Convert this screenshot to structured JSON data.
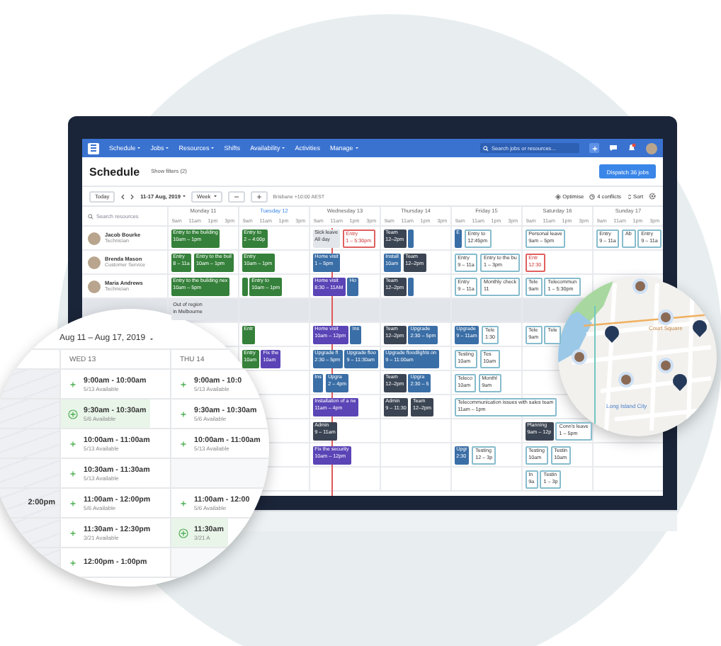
{
  "nav": {
    "items": [
      {
        "label": "Schedule",
        "dropdown": true
      },
      {
        "label": "Jobs",
        "dropdown": true
      },
      {
        "label": "Resources",
        "dropdown": true
      },
      {
        "label": "Shifts",
        "dropdown": false
      },
      {
        "label": "Availability",
        "dropdown": true
      },
      {
        "label": "Activities",
        "dropdown": false
      },
      {
        "label": "Manage",
        "dropdown": true
      }
    ],
    "search": {
      "placeholder": "Search jobs or resources..."
    }
  },
  "header": {
    "title": "Schedule",
    "filters": "Show filters (2)",
    "dispatch": "Dispatch 36 jobs"
  },
  "toolbar": {
    "today": "Today",
    "range": "11-17 Aug, 2019",
    "view": "Week",
    "timezone": "Brisbane +10:00 AEST",
    "optimise": "Optimise",
    "conflicts": "4 conflicts",
    "sort": "Sort"
  },
  "resource_search": {
    "placeholder": "Search resources"
  },
  "days": [
    {
      "name": "Monday 11",
      "selected": false,
      "times": [
        "9am",
        "11am",
        "1pm",
        "3pm"
      ]
    },
    {
      "name": "Tuesday 12",
      "selected": true,
      "times": [
        "9am",
        "11am",
        "1pm",
        "3pm"
      ]
    },
    {
      "name": "Wednesday 13",
      "selected": false,
      "times": [
        "9am",
        "11am",
        "1pm",
        "3pm"
      ]
    },
    {
      "name": "Thursday 14",
      "selected": false,
      "times": [
        "9am",
        "11am",
        "1pm",
        "3pm"
      ]
    },
    {
      "name": "Friday 15",
      "selected": false,
      "times": [
        "9am",
        "11am",
        "1pm",
        "3pm"
      ]
    },
    {
      "name": "Saturday 16",
      "selected": false,
      "times": [
        "9am",
        "11am",
        "1pm",
        "3pm"
      ]
    },
    {
      "name": "Sunday 17",
      "selected": false,
      "times": [
        "9am",
        "11am",
        "1pm",
        "3pm"
      ]
    }
  ],
  "rows": [
    {
      "name": "Jacob Bourke",
      "role": "Technician",
      "shaded": false,
      "days": {
        "mon": [
          {
            "kind": "job",
            "title": "Entry to the building",
            "time": "10am – 1pm"
          }
        ],
        "tue": [
          {
            "kind": "job",
            "title": "Entry to",
            "time": "2 – 4:00p"
          }
        ],
        "wed": [
          {
            "kind": "leave",
            "title": "Sick leave",
            "time": "All day"
          },
          {
            "kind": "alert",
            "title": "Entry",
            "time": "1 – 5:30pm"
          }
        ],
        "thu": [
          {
            "kind": "team",
            "title": "Team",
            "time": "12–2pm"
          },
          {
            "kind": "upgrade"
          }
        ],
        "fri": [
          {
            "kind": "upgrade",
            "title": "E"
          },
          {
            "kind": "outline",
            "title": "Entry to",
            "time": "12:45pm"
          }
        ],
        "sat": [
          {
            "kind": "outline",
            "title": "Personal leave",
            "time": "9am – 5pm"
          }
        ],
        "sun": [
          {
            "kind": "outline",
            "title": "Entry",
            "time": "9 – 11a"
          },
          {
            "kind": "outline",
            "title": "Ab"
          },
          {
            "kind": "outline",
            "title": "Entry",
            "time": "9 – 11a"
          }
        ]
      }
    },
    {
      "name": "Brenda Mason",
      "role": "Customer Service",
      "shaded": false,
      "days": {
        "mon": [
          {
            "kind": "job",
            "title": "Entry",
            "time": "8 – 11a"
          },
          {
            "kind": "job",
            "title": "Entry to the buil",
            "time": "10am – 1pm"
          }
        ],
        "tue": [
          {
            "kind": "job",
            "title": "Entry",
            "time": "10am – 1pm"
          }
        ],
        "wed": [
          {
            "kind": "upgrade",
            "title": "Home visit",
            "time": "1 – 5pm"
          }
        ],
        "thu": [
          {
            "kind": "upgrade",
            "title": "Install",
            "time": "10am"
          },
          {
            "kind": "team",
            "title": "Team",
            "time": "12–2pm"
          }
        ],
        "fri": [
          {
            "kind": "outline",
            "title": "Entry",
            "time": "9 – 11a"
          },
          {
            "kind": "outline",
            "title": "Entry to the bu",
            "time": "1 – 3pm"
          }
        ],
        "sat": [
          {
            "kind": "alert",
            "title": "Entr",
            "time": "12:30"
          }
        ]
      }
    },
    {
      "name": "Maria Andrews",
      "role": "Technician",
      "shaded": false,
      "days": {
        "mon": [
          {
            "kind": "job",
            "title": "Entry to the building nex",
            "time": "10am – 5pm"
          }
        ],
        "tue": [
          {
            "kind": "job"
          },
          {
            "kind": "job",
            "title": "Entry to",
            "time": "10am – 1pm"
          }
        ],
        "wed": [
          {
            "kind": "visit",
            "title": "Home visit",
            "time": "8:30 – 11AM"
          },
          {
            "kind": "upgrade",
            "title": "Ho"
          }
        ],
        "thu": [
          {
            "kind": "team",
            "title": "Team",
            "time": "12–2pm"
          },
          {
            "kind": "upgrade"
          }
        ],
        "fri": [
          {
            "kind": "outline",
            "title": "Entry",
            "time": "9 – 11a"
          },
          {
            "kind": "outline",
            "title": "Monthly check",
            "time": "11"
          }
        ],
        "sat": [
          {
            "kind": "outline",
            "title": "Tele",
            "time": "9am"
          },
          {
            "kind": "outline",
            "title": "Telecommun",
            "time": "1 – 5:30pm"
          }
        ]
      }
    },
    {
      "shaded": true,
      "days": {
        "mon": [
          {
            "kind": "leave",
            "title": "Out of region",
            "time": "in Melbourne"
          }
        ]
      }
    },
    {
      "shaded": false,
      "days": {
        "tue": [
          {
            "kind": "job",
            "title": "Entr"
          }
        ],
        "wed": [
          {
            "kind": "visit",
            "title": "Home visit",
            "time": "10am – 12pm"
          },
          {
            "kind": "upgrade",
            "title": "Ins"
          }
        ],
        "thu": [
          {
            "kind": "team",
            "title": "Team",
            "time": "12–2pm"
          },
          {
            "kind": "upgrade",
            "title": "Upgrade",
            "time": "2:30 – 5pm"
          }
        ],
        "fri": [
          {
            "kind": "upgrade",
            "title": "Upgrade",
            "time": "9 – 11am"
          },
          {
            "kind": "outline",
            "title": "Tele",
            "time": "1:30"
          }
        ],
        "sat": [
          {
            "kind": "outline",
            "title": "Tele",
            "time": "9am"
          },
          {
            "kind": "outline",
            "title": "Tele"
          }
        ]
      }
    },
    {
      "shaded": false,
      "days": {
        "tue": [
          {
            "kind": "job",
            "title": "Entry",
            "time": "10am"
          },
          {
            "kind": "visit",
            "title": "Fix the",
            "time": "10am"
          }
        ],
        "wed": [
          {
            "kind": "upgrade",
            "title": "Upgrade fl",
            "time": "2:30 – 5pm"
          },
          {
            "kind": "upgrade",
            "title": "Upgrade floo",
            "time": "9 – 11:30am"
          }
        ],
        "thu": [
          {
            "kind": "upgrade",
            "title": "Upgrade floodlights on",
            "time": "9 – 11:00am"
          }
        ],
        "fri": [
          {
            "kind": "outline",
            "title": "Testing",
            "time": "10am"
          },
          {
            "kind": "outline",
            "title": "Tes",
            "time": "10am"
          }
        ]
      }
    },
    {
      "shaded": false,
      "days": {
        "wed": [
          {
            "kind": "upgrade",
            "title": "Ins"
          },
          {
            "kind": "upgrade",
            "title": "Upgra",
            "time": "2 – 4pm"
          }
        ],
        "thu": [
          {
            "kind": "team",
            "title": "Team",
            "time": "12–2pm"
          },
          {
            "kind": "upgrade",
            "title": "Upgra",
            "time": "2:30 – 5"
          }
        ],
        "fri": [
          {
            "kind": "outline",
            "title": "Teleco",
            "time": "10am"
          },
          {
            "kind": "outline",
            "title": "Monthl",
            "time": "9am"
          }
        ]
      }
    },
    {
      "shaded": false,
      "days": {
        "wed": [
          {
            "kind": "visit",
            "title": "Installation of a ne",
            "time": "11am – 4pm"
          }
        ],
        "thu": [
          {
            "kind": "team",
            "title": "Admin",
            "time": "9 – 11:30"
          },
          {
            "kind": "team",
            "title": "Team",
            "time": "12–2pm"
          }
        ],
        "fri": [
          {
            "kind": "outline",
            "title": "Telecommunication issues with sales team",
            "time": "11am – 1pm"
          }
        ]
      }
    },
    {
      "shaded": false,
      "days": {
        "wed": [
          {
            "kind": "team",
            "title": "Admin",
            "time": "9 – 11am"
          }
        ],
        "sat": [
          {
            "kind": "team",
            "title": "Planning",
            "time": "9am – 12p"
          },
          {
            "kind": "outline",
            "title": "Conn's leave",
            "time": "1 – 5pm"
          }
        ]
      }
    },
    {
      "shaded": false,
      "days": {
        "wed": [
          {
            "kind": "visit",
            "title": "Fix the security",
            "time": "10am – 12pm"
          }
        ],
        "fri": [
          {
            "kind": "upgrade",
            "title": "Upgr",
            "time": "2:30"
          },
          {
            "kind": "outline",
            "title": "Testing",
            "time": "12 – 3p"
          }
        ],
        "sat": [
          {
            "kind": "outline",
            "title": "Testing",
            "time": "10am"
          },
          {
            "kind": "outline",
            "title": "Testin",
            "time": "10am"
          }
        ]
      }
    },
    {
      "shaded": false,
      "days": {
        "sat": [
          {
            "kind": "outline",
            "title": "In",
            "time": "9a"
          },
          {
            "kind": "outline",
            "title": "Testin",
            "time": "1 – 3p"
          }
        ]
      }
    }
  ],
  "slot_picker": {
    "range": "Aug 11 – Aug 17, 2019",
    "columns": [
      {
        "label": "WED 13"
      },
      {
        "label": "THU 14"
      }
    ],
    "rows": [
      {
        "slots": [
          {
            "time": "9:00am - 10:00am",
            "availability": "5/13 Available",
            "selected": false
          },
          {
            "time": "9:00am - 10:0",
            "availability": "5/13 Available",
            "selected": false
          }
        ]
      },
      {
        "slots": [
          {
            "time": "9:30am - 10:30am",
            "availability": "5/6 Available",
            "selected": true
          },
          {
            "time": "9:30am - 10:30am",
            "availability": "5/6 Available",
            "selected": false
          }
        ]
      },
      {
        "slots": [
          {
            "time": "10:00am - 11:00am",
            "availability": "5/13 Available",
            "selected": false
          },
          {
            "time": "10:00am - 11:00am",
            "availability": "5/13 Available",
            "selected": false
          }
        ]
      },
      {
        "slots": [
          {
            "time": "10:30am - 11:30am",
            "availability": "5/13 Available",
            "selected": false
          }
        ]
      },
      {
        "edge_text": "2:00pm",
        "slots": [
          {
            "time": "11:00am - 12:00pm",
            "availability": "5/6 Available",
            "selected": false
          },
          {
            "time": "11:00am - 12:00",
            "availability": "5/6 Available",
            "selected": false
          }
        ]
      },
      {
        "slots": [
          {
            "time": "11:30am - 12:30pm",
            "availability": "3/21 Available",
            "selected": false
          },
          {
            "time": "11:30am",
            "availability": "3/21 A",
            "selected": true
          }
        ]
      },
      {
        "slots": [
          {
            "time": "12:00pm - 1:00pm",
            "selected": false
          }
        ]
      }
    ]
  },
  "map": {
    "labels": [
      "Court Square",
      "Long Island City"
    ]
  }
}
